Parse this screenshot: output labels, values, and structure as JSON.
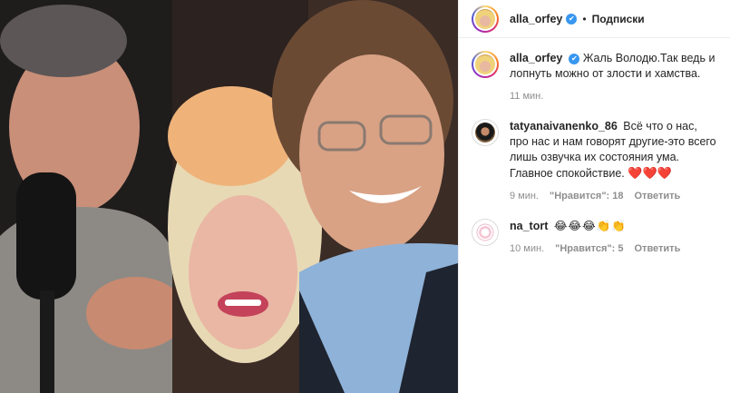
{
  "post": {
    "author": "alla_orfey",
    "separator": "•",
    "follow_label": "Подписки",
    "caption": {
      "user": "alla_orfey",
      "text": "Жаль Володю.Так ведь и лопнуть можно от злости и хамства.",
      "time": "11 мин."
    }
  },
  "comments": [
    {
      "user": "tatyanaivanenko_86",
      "text": "Всё что о нас, про нас и нам говорят другие-это всего лишь озвучка их состояния ума. Главное спокойствие.",
      "hearts": "❤️❤️❤️",
      "time": "9 мин.",
      "likes": "\"Нравится\": 18",
      "reply": "Ответить"
    },
    {
      "user": "na_tort",
      "text": "😂😂😂👏👏",
      "time": "10 мин.",
      "likes": "\"Нравится\": 5",
      "reply": "Ответить"
    }
  ],
  "colors": {
    "verified": "#3897f0",
    "heart": "#ed1c3c",
    "meta": "#8e8e8e",
    "text": "#262626"
  },
  "icons": {
    "verified": "verified-badge-icon",
    "heart": "heart-icon"
  }
}
